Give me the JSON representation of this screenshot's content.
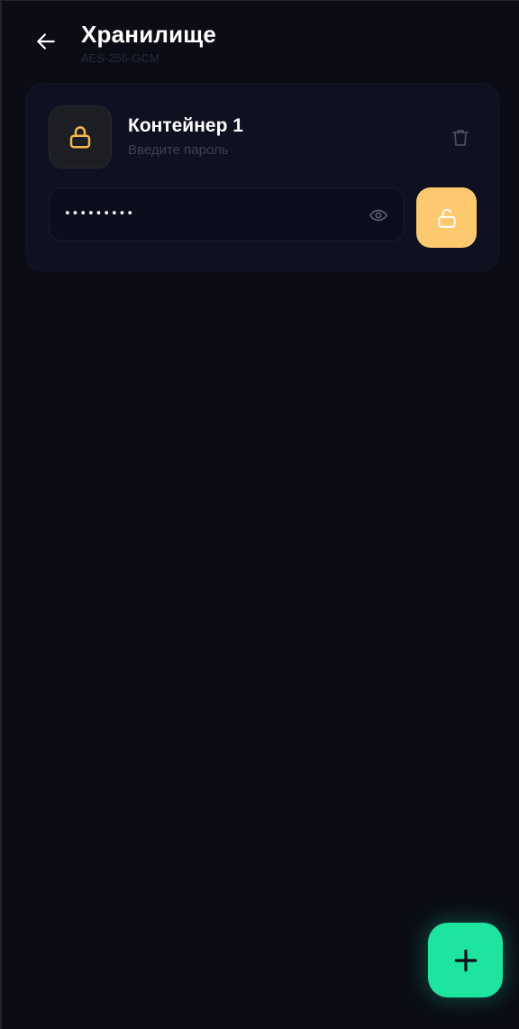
{
  "header": {
    "title": "Хранилище",
    "subtitle": "AES-256-GCM",
    "back_icon": "arrow-left-icon"
  },
  "containers": [
    {
      "name": "Контейнер 1",
      "hint": "Введите пароль",
      "lock_icon": "lock-icon",
      "delete_icon": "trash-icon",
      "password_value": "•••••••••",
      "password_placeholder": "",
      "reveal_icon": "eye-icon",
      "unlock_icon": "unlock-icon"
    }
  ],
  "fab": {
    "icon": "plus-icon"
  },
  "colors": {
    "background": "#0b0c16",
    "card": "#0f1020",
    "accent_unlock": "#fcc96e",
    "accent_lock_icon": "#f5b84c",
    "accent_fab": "#1de59f"
  }
}
